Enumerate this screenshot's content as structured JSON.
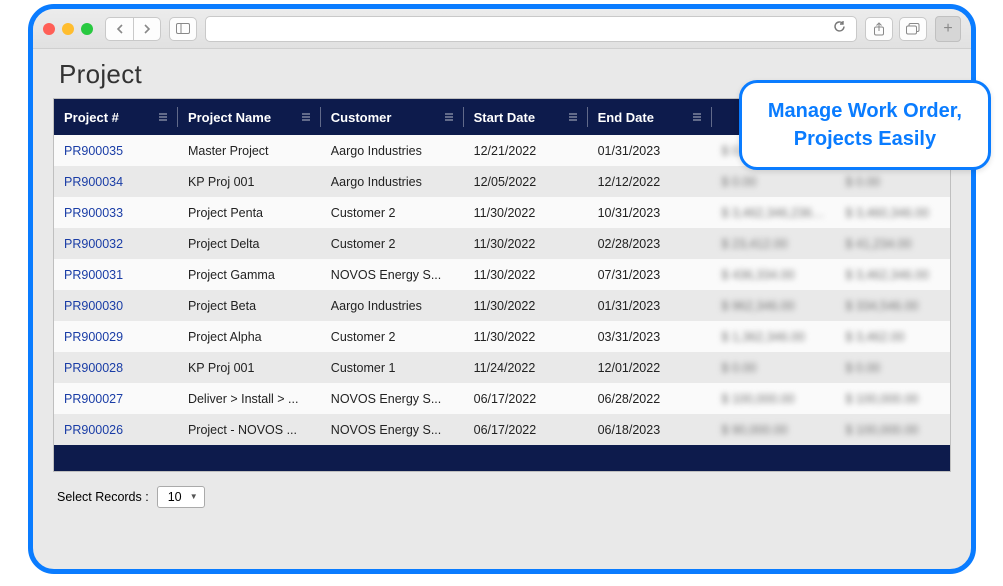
{
  "page": {
    "title": "Project"
  },
  "callout": {
    "line1": "Manage Work Order,",
    "line2": "Projects Easily"
  },
  "selectRecords": {
    "label": "Select Records :",
    "value": "10"
  },
  "columns": [
    {
      "label": "Project #"
    },
    {
      "label": "Project Name"
    },
    {
      "label": "Customer"
    },
    {
      "label": "Start Date"
    },
    {
      "label": "End Date"
    },
    {
      "label": ""
    },
    {
      "label": ""
    }
  ],
  "rows": [
    {
      "id": "PR900035",
      "name": "Master Project",
      "customer": "Aargo Industries",
      "start": "12/21/2022",
      "end": "01/31/2023",
      "a": "$ 0.00",
      "b": "$ 0.00"
    },
    {
      "id": "PR900034",
      "name": "KP Proj 001",
      "customer": "Aargo Industries",
      "start": "12/05/2022",
      "end": "12/12/2022",
      "a": "$ 0.00",
      "b": "$ 0.00"
    },
    {
      "id": "PR900033",
      "name": "Project Penta",
      "customer": "Customer 2",
      "start": "11/30/2022",
      "end": "10/31/2023",
      "a": "$ 3,462,346,236.00",
      "b": "$ 3,460,346.00"
    },
    {
      "id": "PR900032",
      "name": "Project Delta",
      "customer": "Customer 2",
      "start": "11/30/2022",
      "end": "02/28/2023",
      "a": "$ 23,412.00",
      "b": "$ 41,234.00"
    },
    {
      "id": "PR900031",
      "name": "Project Gamma",
      "customer": "NOVOS Energy S...",
      "start": "11/30/2022",
      "end": "07/31/2023",
      "a": "$ 436,334.00",
      "b": "$ 3,462,346.00"
    },
    {
      "id": "PR900030",
      "name": "Project Beta",
      "customer": "Aargo Industries",
      "start": "11/30/2022",
      "end": "01/31/2023",
      "a": "$ 962,346.00",
      "b": "$ 334,546.00"
    },
    {
      "id": "PR900029",
      "name": "Project Alpha",
      "customer": "Customer 2",
      "start": "11/30/2022",
      "end": "03/31/2023",
      "a": "$ 1,362,346.00",
      "b": "$ 3,462.00"
    },
    {
      "id": "PR900028",
      "name": "KP Proj 001",
      "customer": "Customer 1",
      "start": "11/24/2022",
      "end": "12/01/2022",
      "a": "$ 0.00",
      "b": "$ 0.00"
    },
    {
      "id": "PR900027",
      "name": "Deliver > Install > ...",
      "customer": "NOVOS Energy S...",
      "start": "06/17/2022",
      "end": "06/28/2022",
      "a": "$ 100,000.00",
      "b": "$ 100,000.00"
    },
    {
      "id": "PR900026",
      "name": "Project - NOVOS ...",
      "customer": "NOVOS Energy S...",
      "start": "06/17/2022",
      "end": "06/18/2023",
      "a": "$ 90,000.00",
      "b": "$ 100,000.00"
    }
  ]
}
